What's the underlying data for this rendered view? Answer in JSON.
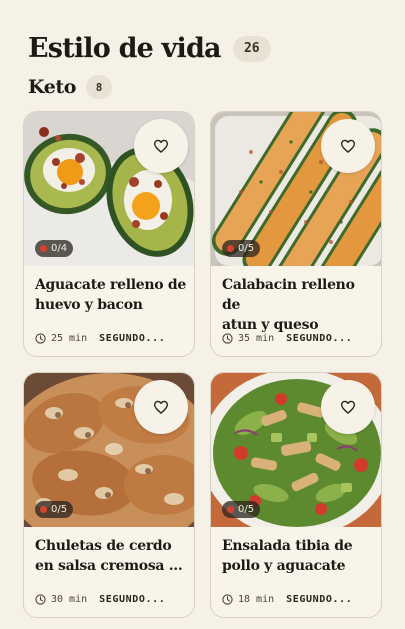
{
  "header": {
    "title": "Estilo de vida",
    "count": "26"
  },
  "section": {
    "title": "Keto",
    "count": "8"
  },
  "cards": [
    {
      "title_l1": "Aguacate relleno de",
      "title_l2": "huevo y bacon",
      "progress": "0/4",
      "time": "25 min",
      "type": "SEGUNDO...",
      "photo_icon": "avocado-egg-photo"
    },
    {
      "title_l1": "Calabacin relleno de",
      "title_l2": "atun y queso",
      "progress": "0/5",
      "time": "35 min",
      "type": "SEGUNDO...",
      "photo_icon": "stuffed-zucchini-photo"
    },
    {
      "title_l1": "Chuletas de cerdo",
      "title_l2": "en salsa cremosa d...",
      "progress": "0/5",
      "time": "30 min",
      "type": "SEGUNDO...",
      "photo_icon": "pork-chops-photo"
    },
    {
      "title_l1": "Ensalada tibia de",
      "title_l2": "pollo y aguacate",
      "progress": "0/5",
      "time": "18 min",
      "type": "SEGUNDO...",
      "photo_icon": "chicken-salad-photo"
    }
  ],
  "colors": {
    "background": "#f6f1e7",
    "card": "#f8f4ea",
    "badge": "#e7e2d4",
    "progress_dot": "#d8402f"
  }
}
